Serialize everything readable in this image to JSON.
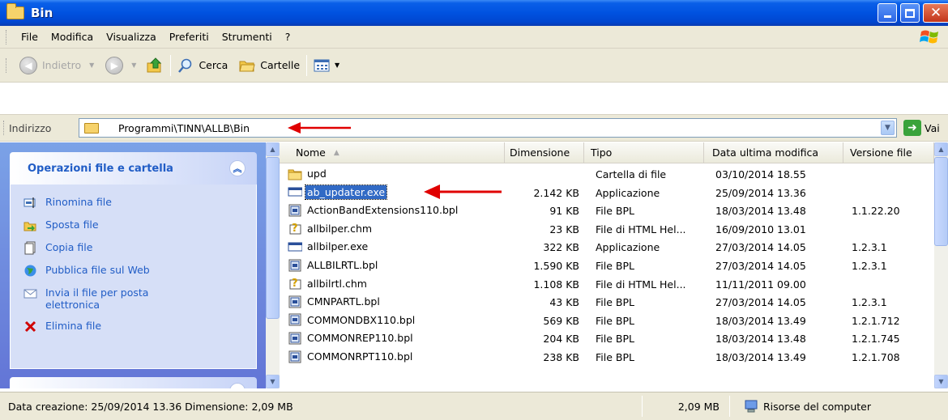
{
  "window": {
    "title": "Bin"
  },
  "menu": [
    "File",
    "Modifica",
    "Visualizza",
    "Preferiti",
    "Strumenti",
    "?"
  ],
  "toolbar": {
    "back": "Indietro",
    "search": "Cerca",
    "folders": "Cartelle"
  },
  "address": {
    "label": "Indirizzo",
    "path": "Programmi\\TINN\\ALLB\\Bin",
    "go": "Vai"
  },
  "taskpane": {
    "title": "Operazioni file e cartella",
    "items": [
      {
        "label": "Rinomina file",
        "icon": "rename-icon"
      },
      {
        "label": "Sposta file",
        "icon": "move-icon"
      },
      {
        "label": "Copia file",
        "icon": "copy-icon"
      },
      {
        "label": "Pubblica file sul Web",
        "icon": "publish-web-icon"
      },
      {
        "label": "Invia il file per posta elettronica",
        "icon": "email-icon"
      },
      {
        "label": "Elimina file",
        "icon": "delete-icon"
      }
    ]
  },
  "columns": {
    "name": "Nome",
    "size": "Dimensione",
    "type": "Tipo",
    "modified": "Data ultima modifica",
    "version": "Versione file"
  },
  "files": [
    {
      "name": "upd",
      "size": "",
      "type": "Cartella di file",
      "modified": "03/10/2014 18.55",
      "version": "",
      "icon": "folder-icon"
    },
    {
      "name": "ab_updater.exe",
      "size": "2.142 KB",
      "type": "Applicazione",
      "modified": "25/09/2014 13.36",
      "version": "",
      "icon": "exe-icon"
    },
    {
      "name": "ActionBandExtensions110.bpl",
      "size": "91 KB",
      "type": "File BPL",
      "modified": "18/03/2014 13.48",
      "version": "1.1.22.20",
      "icon": "bpl-icon"
    },
    {
      "name": "allbilper.chm",
      "size": "23 KB",
      "type": "File di HTML Hel...",
      "modified": "16/09/2010 13.01",
      "version": "",
      "icon": "chm-icon"
    },
    {
      "name": "allbilper.exe",
      "size": "322 KB",
      "type": "Applicazione",
      "modified": "27/03/2014 14.05",
      "version": "1.2.3.1",
      "icon": "exe-icon"
    },
    {
      "name": "ALLBILRTL.bpl",
      "size": "1.590 KB",
      "type": "File BPL",
      "modified": "27/03/2014 14.05",
      "version": "1.2.3.1",
      "icon": "bpl-icon"
    },
    {
      "name": "allbilrtl.chm",
      "size": "1.108 KB",
      "type": "File di HTML Hel...",
      "modified": "11/11/2011 09.00",
      "version": "",
      "icon": "chm-icon"
    },
    {
      "name": "CMNPARTL.bpl",
      "size": "43 KB",
      "type": "File BPL",
      "modified": "27/03/2014 14.05",
      "version": "1.2.3.1",
      "icon": "bpl-icon"
    },
    {
      "name": "COMMONDBX110.bpl",
      "size": "569 KB",
      "type": "File BPL",
      "modified": "18/03/2014 13.49",
      "version": "1.2.1.712",
      "icon": "bpl-icon"
    },
    {
      "name": "COMMONREP110.bpl",
      "size": "204 KB",
      "type": "File BPL",
      "modified": "18/03/2014 13.48",
      "version": "1.2.1.745",
      "icon": "bpl-icon"
    },
    {
      "name": "COMMONRPT110.bpl",
      "size": "238 KB",
      "type": "File BPL",
      "modified": "18/03/2014 13.49",
      "version": "1.2.1.708",
      "icon": "bpl-icon"
    }
  ],
  "status": {
    "info": "Data creazione: 25/09/2014 13.36 Dimensione: 2,09 MB",
    "size": "2,09 MB",
    "zone": "Risorse del computer"
  },
  "colors": {
    "titlebar": "#0052e0",
    "selection": "#316ac5",
    "link": "#215dc6",
    "annotation": "#e00000"
  }
}
